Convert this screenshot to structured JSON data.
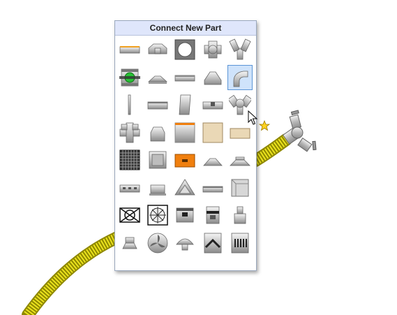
{
  "panel": {
    "title": "Connect New Part",
    "selected_index": 9,
    "parts": [
      {
        "name": "flat-rect-duct-icon"
      },
      {
        "name": "rect-tee-icon"
      },
      {
        "name": "round-grille-icon"
      },
      {
        "name": "cross-fitting-icon"
      },
      {
        "name": "wye-fitting-icon"
      },
      {
        "name": "green-valve-icon"
      },
      {
        "name": "low-tee-icon"
      },
      {
        "name": "flat-duct-section-icon"
      },
      {
        "name": "transition-tee-icon"
      },
      {
        "name": "elbow-icon"
      },
      {
        "name": "thin-rod-icon"
      },
      {
        "name": "short-duct-icon"
      },
      {
        "name": "rect-plate-icon"
      },
      {
        "name": "reducer-section-icon"
      },
      {
        "name": "wye-branch-icon"
      },
      {
        "name": "four-way-cross-icon"
      },
      {
        "name": "hood-icon"
      },
      {
        "name": "orange-edge-panel-icon"
      },
      {
        "name": "tan-panel-icon"
      },
      {
        "name": "tan-strip-icon"
      },
      {
        "name": "dark-grille-icon"
      },
      {
        "name": "metal-box-icon"
      },
      {
        "name": "orange-box-icon"
      },
      {
        "name": "flat-hood-icon"
      },
      {
        "name": "round-diffuser-icon"
      },
      {
        "name": "slot-diffuser-icon"
      },
      {
        "name": "short-hood-icon"
      },
      {
        "name": "pyramid-icon"
      },
      {
        "name": "small-duct-icon"
      },
      {
        "name": "open-box-icon"
      },
      {
        "name": "x-damper-icon"
      },
      {
        "name": "fan-grille-icon"
      },
      {
        "name": "round-coupler-icon"
      },
      {
        "name": "round-fitting-icon"
      },
      {
        "name": "nozzle-icon"
      },
      {
        "name": "cap-fitting-icon"
      },
      {
        "name": "fan-disc-icon"
      },
      {
        "name": "mushroom-cap-icon"
      },
      {
        "name": "chevron-cylinder-icon"
      },
      {
        "name": "grill-cylinder-icon"
      }
    ]
  },
  "colors": {
    "hose": "#e5de1a",
    "hose_dark": "#a9a20a",
    "selection": "#cfe3fb",
    "accent_green": "#27c234",
    "accent_orange": "#f07f0e"
  }
}
